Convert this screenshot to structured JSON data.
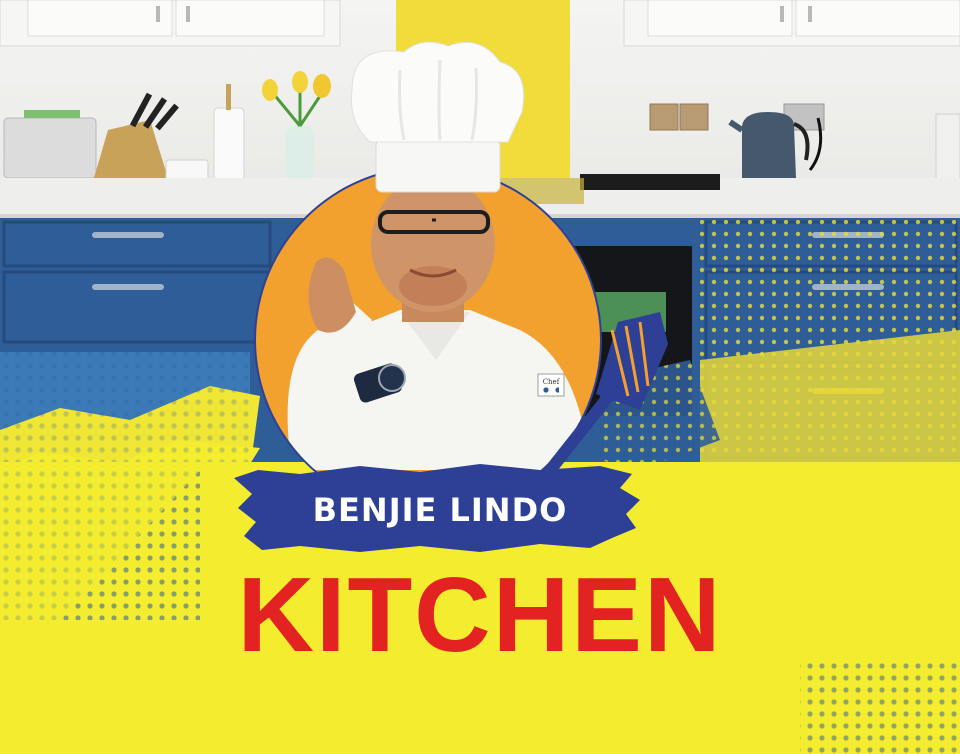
{
  "logo": {
    "name_line": "BENJIE LINDO",
    "title_line": "KITCHEN",
    "jacket_badge": "Chef"
  },
  "colors": {
    "cabinet_blue": "#2f5d98",
    "brand_yellow": "#f4ec2e",
    "brush_navy": "#2e3f96",
    "title_red": "#e32222",
    "circle_orange": "#f2a12e"
  },
  "icons": [
    "chef-hat-icon",
    "spatula-icon",
    "kettle-icon",
    "knife-block-icon",
    "tulip-vase-icon"
  ]
}
